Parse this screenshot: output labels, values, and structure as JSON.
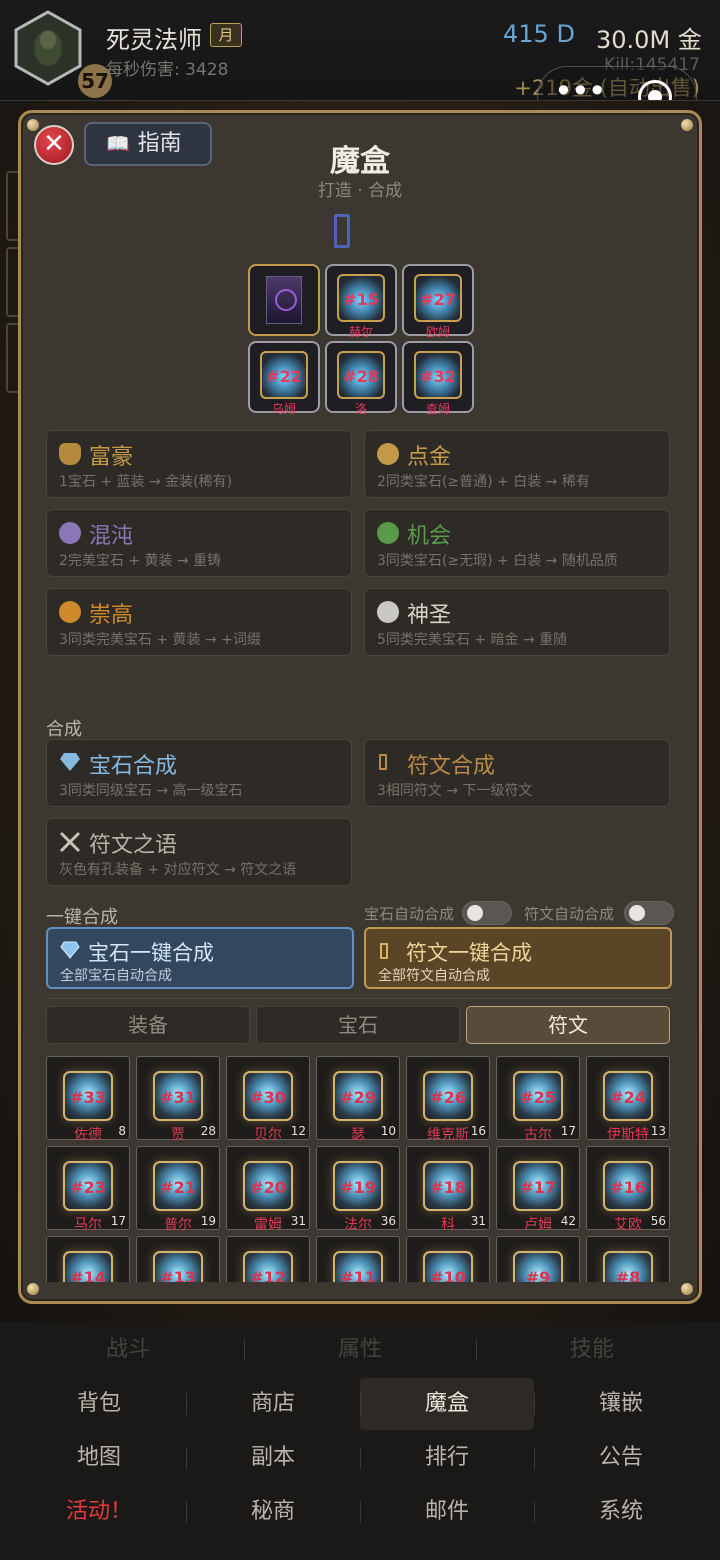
{
  "header": {
    "player_name": "死灵法师",
    "month_badge": "月",
    "level": "57",
    "dps": "每秒伤害: 3428",
    "diamonds": "415 D",
    "gold": "30.0M 金",
    "kills": "Kill:145417",
    "autosell": "+219金 (自动出售)"
  },
  "modal": {
    "close_label": "✕",
    "guide_label": "指南",
    "title": "魔盒",
    "subtitle": "打造 · 合成",
    "slots": [
      {
        "num": "",
        "name": "",
        "kind": "book"
      },
      {
        "num": "#15",
        "name": "赫尔",
        "kind": "rune"
      },
      {
        "num": "#27",
        "name": "欧姆",
        "kind": "rune"
      },
      {
        "num": "#22",
        "name": "乌姆",
        "kind": "rune"
      },
      {
        "num": "#28",
        "name": "洛",
        "kind": "rune"
      },
      {
        "num": "#32",
        "name": "查姆",
        "kind": "rune"
      }
    ],
    "recipes": [
      {
        "title": "富豪",
        "desc": "1宝石 + 蓝装 → 金装(稀有)",
        "icon": "money-bag-icon",
        "color": "#c49a48"
      },
      {
        "title": "点金",
        "desc": "2同类宝石(≥普通) + 白装 → 稀有",
        "icon": "gold-orb-icon",
        "color": "#c49a48"
      },
      {
        "title": "混沌",
        "desc": "2完美宝石 + 黄装 → 重铸",
        "icon": "purple-orb-icon",
        "color": "#8b76b8"
      },
      {
        "title": "机会",
        "desc": "3同类宝石(≥无瑕) + 白装 → 随机品质",
        "icon": "green-orb-icon",
        "color": "#5a9a4a"
      },
      {
        "title": "崇高",
        "desc": "3同类完美宝石 + 黄装 → +词缀",
        "icon": "orange-orb-icon",
        "color": "#d08a2a"
      },
      {
        "title": "神圣",
        "desc": "5同类完美宝石 + 暗金 → 重随",
        "icon": "white-orb-icon",
        "color": "#c9c7c2"
      }
    ],
    "synth_header": "合成",
    "synth": [
      {
        "title": "宝石合成",
        "desc": "3同类同级宝石 → 高一级宝石",
        "icon": "diamond-icon",
        "color": "#86b8e0"
      },
      {
        "title": "符文合成",
        "desc": "3相同符文 → 下一级符文",
        "icon": "rune-icon",
        "color": "#b98a48"
      },
      {
        "title": "符文之语",
        "desc": "灰色有孔装备 + 对应符文 → 符文之语",
        "icon": "crossed-swords-icon",
        "color": "#b8b2a8"
      }
    ],
    "onekey_header": "一键合成",
    "toggles": {
      "gem_auto": "宝石自动合成",
      "rune_auto": "符文自动合成"
    },
    "onekey": {
      "gem_title": "宝石一键合成",
      "gem_desc": "全部宝石自动合成",
      "rune_title": "符文一键合成",
      "rune_desc": "全部符文自动合成"
    },
    "tabs": [
      "装备",
      "宝石",
      "符文"
    ],
    "active_tab": "符文",
    "runes": [
      {
        "num": "#33",
        "name": "佐德",
        "count": "8"
      },
      {
        "num": "#31",
        "name": "贾",
        "count": "28"
      },
      {
        "num": "#30",
        "name": "贝尔",
        "count": "12"
      },
      {
        "num": "#29",
        "name": "瑟",
        "count": "10"
      },
      {
        "num": "#26",
        "name": "维克斯",
        "count": "16"
      },
      {
        "num": "#25",
        "name": "古尔",
        "count": "17"
      },
      {
        "num": "#24",
        "name": "伊斯特",
        "count": "13"
      },
      {
        "num": "#23",
        "name": "马尔",
        "count": "17"
      },
      {
        "num": "#21",
        "name": "普尔",
        "count": "19"
      },
      {
        "num": "#20",
        "name": "雷姆",
        "count": "31"
      },
      {
        "num": "#19",
        "name": "法尔",
        "count": "36"
      },
      {
        "num": "#18",
        "name": "科",
        "count": "31"
      },
      {
        "num": "#17",
        "name": "卢姆",
        "count": "42"
      },
      {
        "num": "#16",
        "name": "艾欧",
        "count": "56"
      },
      {
        "num": "#14",
        "name": "",
        "count": ""
      },
      {
        "num": "#13",
        "name": "",
        "count": ""
      },
      {
        "num": "#12",
        "name": "",
        "count": ""
      },
      {
        "num": "#11",
        "name": "",
        "count": ""
      },
      {
        "num": "#10",
        "name": "",
        "count": ""
      },
      {
        "num": "#9",
        "name": "",
        "count": ""
      },
      {
        "num": "#8",
        "name": "",
        "count": ""
      }
    ]
  },
  "nav": {
    "row1": [
      "战斗",
      "属性",
      "技能"
    ],
    "row2": [
      "背包",
      "商店",
      "魔盒",
      "镶嵌"
    ],
    "row3": [
      "地图",
      "副本",
      "排行",
      "公告"
    ],
    "row4": [
      "活动！",
      "秘商",
      "邮件",
      "系统"
    ],
    "current": "魔盒"
  },
  "colors": {
    "accent_gold": "#a88a52",
    "rune_red": "#d8334f",
    "gem_blue": "#69a6d4"
  }
}
